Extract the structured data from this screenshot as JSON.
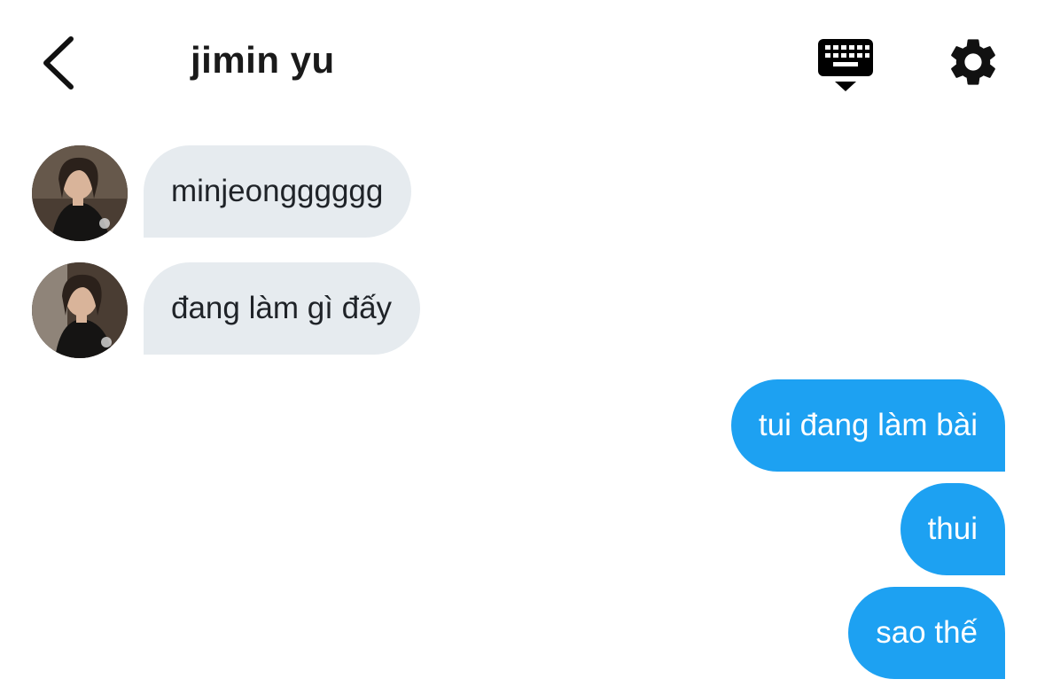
{
  "header": {
    "title": "jimin yu",
    "back_icon": "chevron-left-icon",
    "keyboard_icon": "keyboard-hide-icon",
    "settings_icon": "gear-icon"
  },
  "messages": [
    {
      "direction": "incoming",
      "text": "minjeongggggg"
    },
    {
      "direction": "incoming",
      "text": "đang làm gì đấy"
    },
    {
      "direction": "outgoing",
      "text": "tui đang làm bài"
    },
    {
      "direction": "outgoing",
      "text": "thui"
    },
    {
      "direction": "outgoing",
      "text": "sao thế"
    }
  ],
  "colors": {
    "incoming_bubble": "#e6ebef",
    "outgoing_bubble": "#1da1f2",
    "background": "#ffffff"
  }
}
